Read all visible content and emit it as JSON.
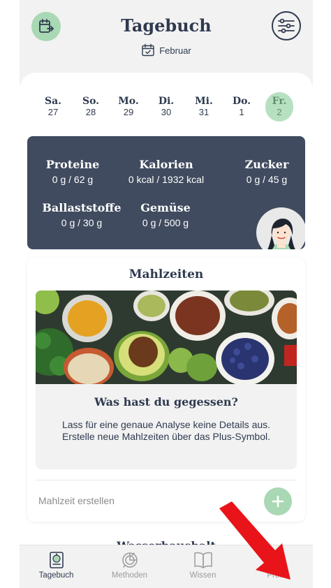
{
  "header": {
    "title": "Tagebuch",
    "month": "Februar"
  },
  "days": [
    {
      "name": "Sa.",
      "date": "27",
      "active": false
    },
    {
      "name": "So.",
      "date": "28",
      "active": false
    },
    {
      "name": "Mo.",
      "date": "29",
      "active": false
    },
    {
      "name": "Di.",
      "date": "30",
      "active": false
    },
    {
      "name": "Mi.",
      "date": "31",
      "active": false
    },
    {
      "name": "Do.",
      "date": "1",
      "active": false
    },
    {
      "name": "Fr.",
      "date": "2",
      "active": true
    }
  ],
  "nutrition": {
    "proteins": {
      "label": "Proteine",
      "value": "0 g / 62 g"
    },
    "calories": {
      "label": "Kalorien",
      "value": "0 kcal / 1932 kcal"
    },
    "sugar": {
      "label": "Zucker",
      "value": "0 g / 45 g"
    },
    "fiber": {
      "label": "Ballaststoffe",
      "value": "0 g / 30 g"
    },
    "vegetables": {
      "label": "Gemüse",
      "value": "0 g / 500 g"
    }
  },
  "meals": {
    "title": "Mahlzeiten",
    "question": "Was hast du gegessen?",
    "description": "Lass für eine genaue Analyse keine Details aus. Erstelle neue Mahlzeiten über das Plus-Symbol.",
    "create_label": "Mahlzeit erstellen"
  },
  "next_card": {
    "title": "Wasserhaushalt"
  },
  "tabs": [
    {
      "label": "Tagebuch",
      "icon": "diary-icon",
      "active": true
    },
    {
      "label": "Methoden",
      "icon": "methods-icon",
      "active": false
    },
    {
      "label": "Wissen",
      "icon": "book-icon",
      "active": false
    },
    {
      "label": "Profil",
      "icon": "profile-icon",
      "active": false
    }
  ],
  "colors": {
    "accent": "#a9d8b4",
    "dark": "#404b5f",
    "text": "#2f3a4f",
    "arrow": "#e8141a"
  }
}
